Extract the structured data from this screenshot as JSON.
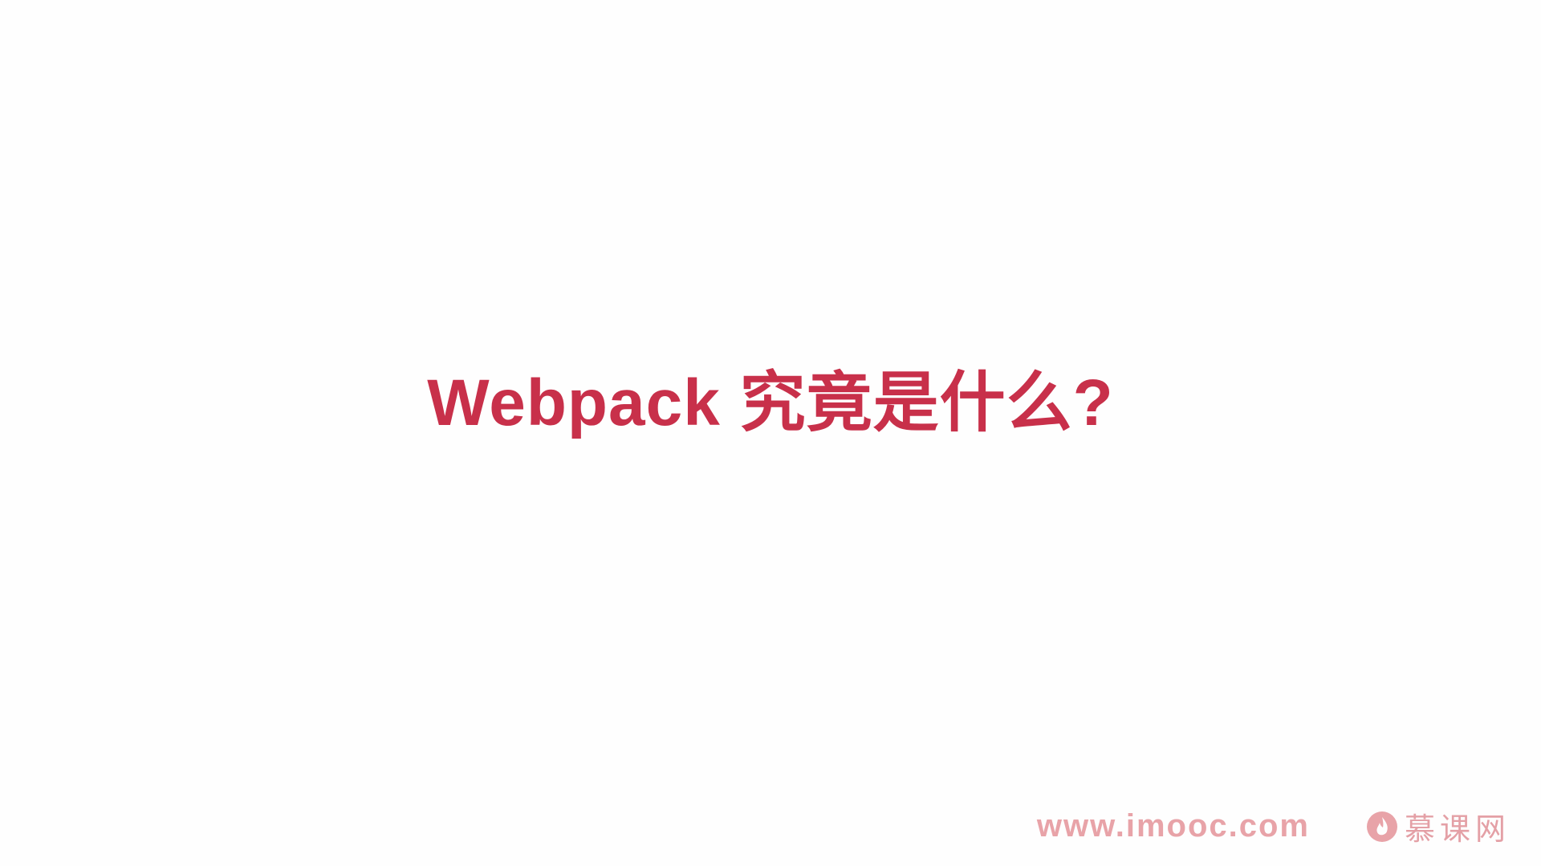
{
  "slide": {
    "title": "Webpack 究竟是什么?"
  },
  "watermark": {
    "url": "www.imooc.com",
    "brand": "慕课网",
    "logo_icon": "imooc-flame-logo-icon"
  },
  "colors": {
    "title": "#c8304a",
    "watermark": "#e8a3a8",
    "background": "#fefefe"
  }
}
